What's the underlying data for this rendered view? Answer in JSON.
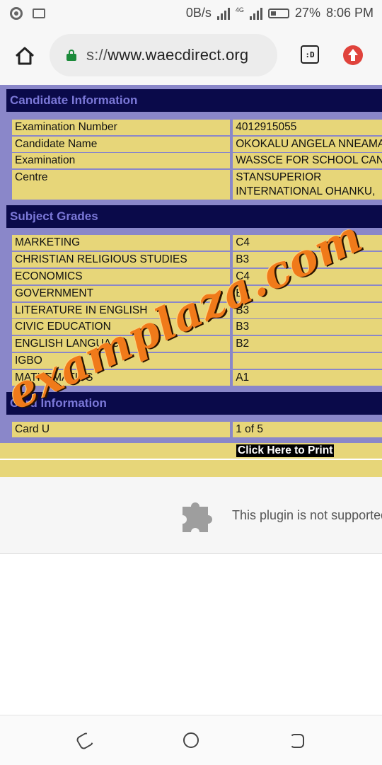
{
  "status_bar": {
    "network_speed": "0B/s",
    "network_type": "4G",
    "battery": "27%",
    "time": "8:06 PM"
  },
  "browser": {
    "url_scheme": "s://",
    "url_host": "www.waecdirect.org",
    "tab_label": ":D"
  },
  "candidate": {
    "header": "Candidate Information",
    "rows": [
      {
        "label": "Examination Number",
        "value": "4012915055"
      },
      {
        "label": "Candidate Name",
        "value": "OKOKALU ANGELA NNEAMAKA"
      },
      {
        "label": "Examination",
        "value": "WASSCE FOR SCHOOL CANDIDATES"
      },
      {
        "label": "Centre",
        "value": "STANSUPERIOR INTERNATIONAL OHANKU, ABA"
      }
    ]
  },
  "grades": {
    "header": "Subject Grades",
    "rows": [
      {
        "subject": "MARKETING",
        "grade": "C4"
      },
      {
        "subject": "CHRISTIAN RELIGIOUS STUDIES",
        "grade": "B3"
      },
      {
        "subject": "ECONOMICS",
        "grade": "C4"
      },
      {
        "subject": "GOVERNMENT",
        "grade": "B3"
      },
      {
        "subject": "LITERATURE IN ENGLISH",
        "grade": "B3"
      },
      {
        "subject": "CIVIC EDUCATION",
        "grade": "B3"
      },
      {
        "subject": "ENGLISH LANGUAGE",
        "grade": "B2"
      },
      {
        "subject": "IGBO",
        "grade": ""
      },
      {
        "subject": "MATHEMATICS",
        "grade": "A1"
      }
    ]
  },
  "card": {
    "header": "Card Information",
    "rows": [
      {
        "label": "Card U",
        "value": "1 of 5"
      }
    ]
  },
  "print_label": "Click Here to Print",
  "plugin_message": "This plugin is not supported",
  "watermark": "examplaza.com"
}
